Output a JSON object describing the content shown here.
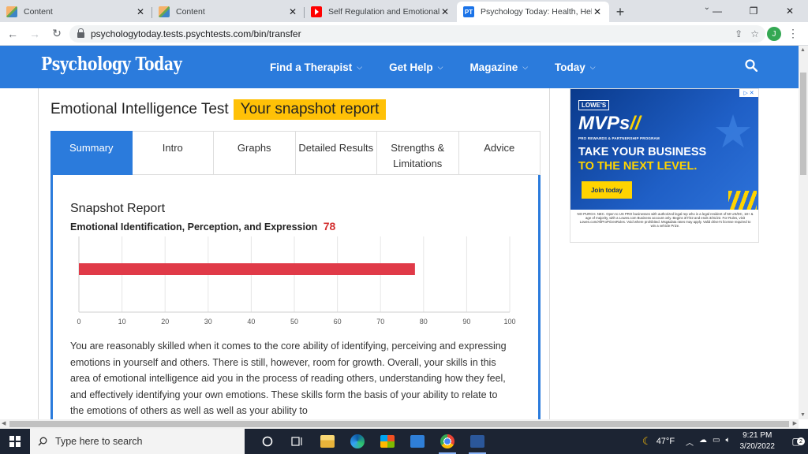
{
  "browser": {
    "tabs": [
      {
        "title": "Content",
        "favicon": "content-favicon",
        "active": false
      },
      {
        "title": "Content",
        "favicon": "content-favicon",
        "active": false
      },
      {
        "title": "Self Regulation and Emotional Int",
        "favicon": "youtube-favicon",
        "active": false
      },
      {
        "title": "Psychology Today: Health, Help, H",
        "favicon": "pt-favicon",
        "active": true
      }
    ],
    "pt_favicon_text": "PT",
    "url": "psychologytoday.tests.psychtests.com/bin/transfer",
    "profile_initial": "J"
  },
  "site": {
    "logo": "Psychology Today",
    "nav": [
      {
        "label": "Find a Therapist"
      },
      {
        "label": "Get Help"
      },
      {
        "label": "Magazine"
      },
      {
        "label": "Today"
      }
    ]
  },
  "report": {
    "test_title": "Emotional Intelligence Test",
    "report_badge": "Your snapshot report",
    "tabs": [
      "Summary",
      "Intro",
      "Graphs",
      "Detailed Results",
      "Strengths & Limitations",
      "Advice"
    ],
    "active_tab": "Summary",
    "section_heading": "Snapshot Report",
    "subscale_label": "Emotional Identification, Perception, and Expression",
    "score": "78",
    "description": "You are reasonably skilled when it comes to the core ability of identifying, perceiving and expressing emotions in yourself and others. There is still, however, room for growth. Overall, your skills in this area of emotional intelligence aid you in the process of reading others, understanding how they feel, and effectively identifying your own emotions. These skills form the basis of your ability to relate to the emotions of others as well as well as your ability to"
  },
  "chart_data": {
    "type": "bar",
    "orientation": "horizontal",
    "values": [
      78
    ],
    "xlim": [
      0,
      100
    ],
    "xticks": [
      "0",
      "10",
      "20",
      "30",
      "40",
      "50",
      "60",
      "70",
      "80",
      "90",
      "100"
    ],
    "bar_color": "#e03a48",
    "grid": true
  },
  "ad": {
    "brand": "LOWE'S",
    "headline": "MVPs",
    "subline": "PRO REWARDS & PARTNERSHIP PROGRAM",
    "line1": "TAKE YOUR BUSINESS",
    "line2": "TO THE NEXT LEVEL.",
    "cta": "Join today",
    "fineprint": "NO PURCH. NEC. Open to US PRO businesses with authorized legal rep who is a legal resident of 50 US/DC, 18+ & age of majority, with a Lowes.com Business account only. Begins 3/7/22 and ends 3/31/22. For Rules, visit Lowes.com/AllProPrizesRules. Void where prohibited. Msg&data rates may apply. Valid driver's license required to win a vehicle Prize."
  },
  "taskbar": {
    "search_placeholder": "Type here to search",
    "temperature": "47°F",
    "time": "9:21 PM",
    "date": "3/20/2022",
    "notifications": "2"
  },
  "colors": {
    "brand_blue": "#2b7bdc",
    "highlight_yellow": "#ffc107",
    "score_red": "#d32f2f"
  }
}
